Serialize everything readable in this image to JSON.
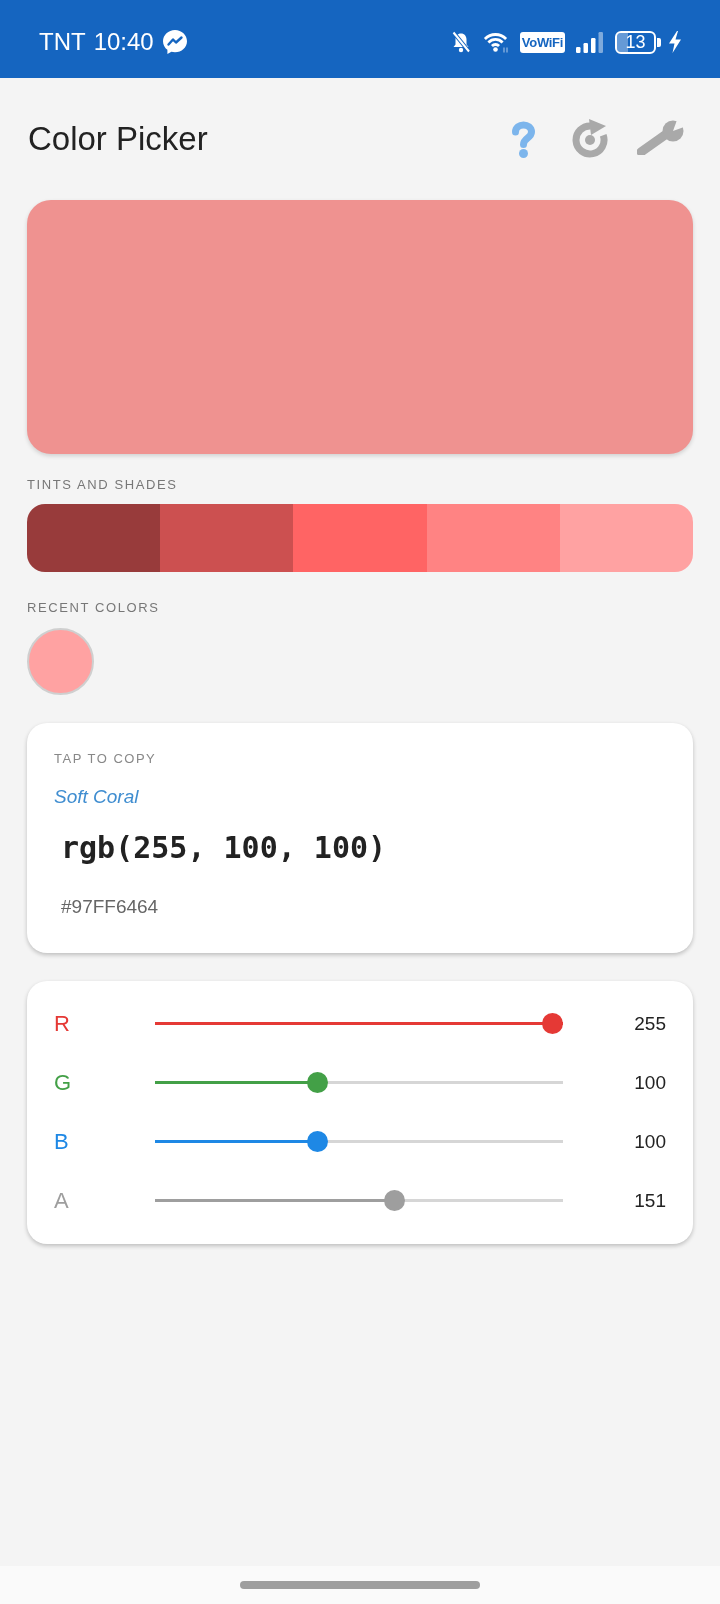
{
  "status_bar": {
    "carrier": "TNT",
    "time": "10:40",
    "network_badge": "VoWiFi",
    "battery": "13"
  },
  "header": {
    "title": "Color Picker"
  },
  "preview": {
    "color": "#ef9290"
  },
  "tints": {
    "label": "TINTS AND SHADES",
    "swatches": [
      {
        "color": "#983b3b"
      },
      {
        "color": "#cc5050"
      },
      {
        "color": "#ff6464"
      },
      {
        "color": "#ff8383"
      },
      {
        "color": "#ffa2a2"
      }
    ]
  },
  "recent": {
    "label": "RECENT COLORS",
    "colors": [
      {
        "color": "#ffa2a2"
      }
    ]
  },
  "copy_card": {
    "hint": "TAP TO COPY",
    "name": "Soft Coral",
    "rgb": "rgb(255, 100, 100)",
    "hex": "#97FF6464"
  },
  "sliders": [
    {
      "label": "R",
      "level": 1,
      "value": "255",
      "color": "#e53935"
    },
    {
      "label": "G",
      "level": 0.392,
      "value": "100",
      "color": "#43a047"
    },
    {
      "label": "B",
      "level": 0.392,
      "value": "100",
      "color": "#1e88e5"
    },
    {
      "label": "A",
      "level": 0.592,
      "value": "151",
      "color": "#9e9e9e"
    }
  ]
}
